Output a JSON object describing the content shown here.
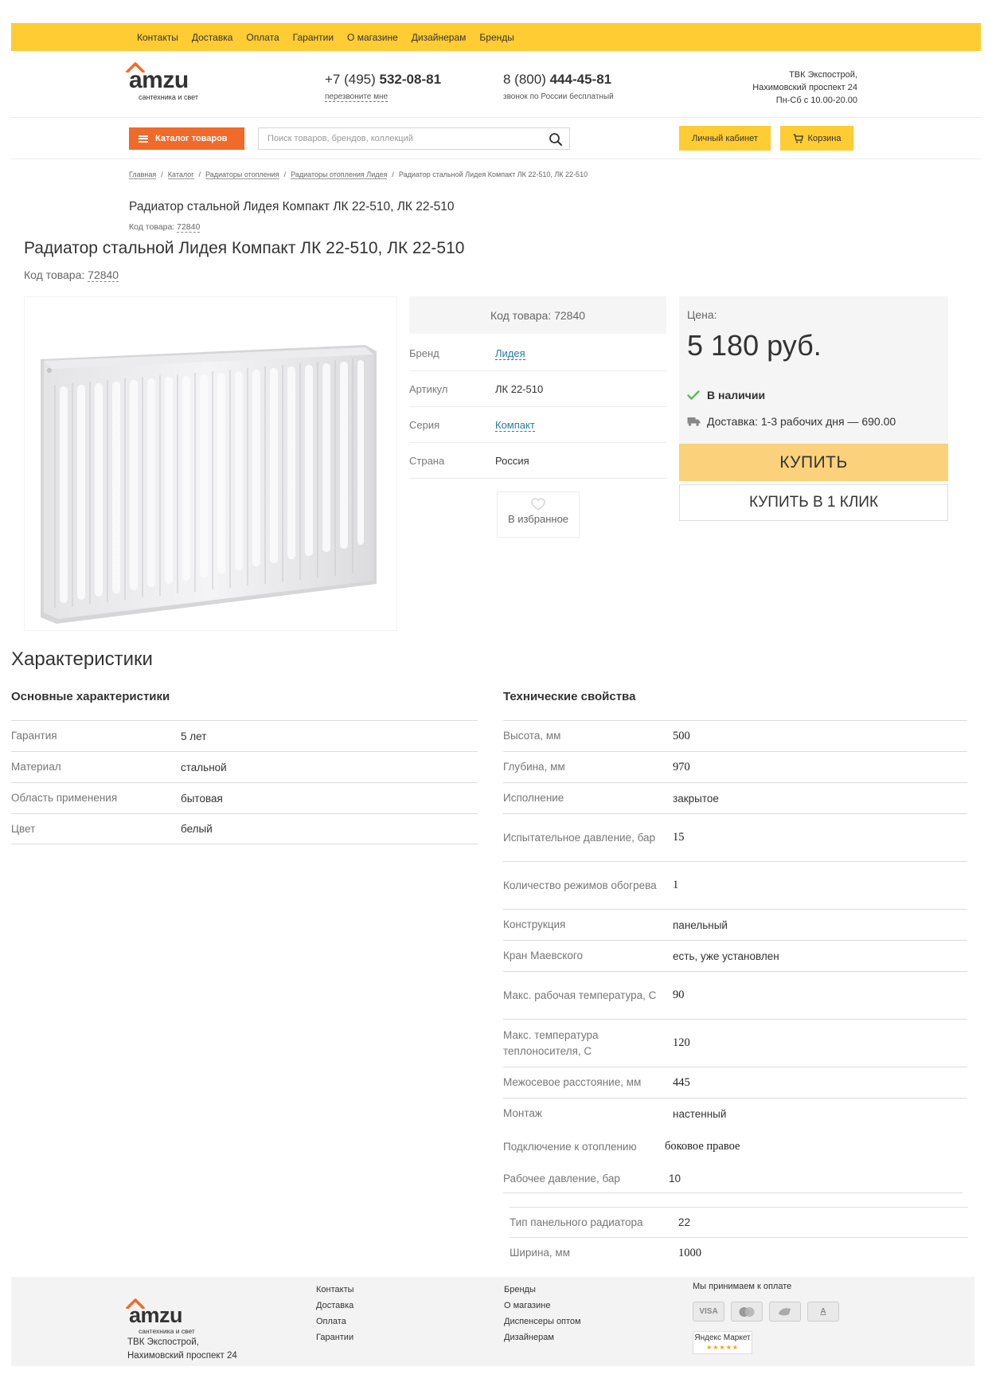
{
  "top_nav": [
    "Контакты",
    "Доставка",
    "Оплата",
    "Гарантии",
    "О магазине",
    "Дизайнерам",
    "Бренды"
  ],
  "logo": {
    "word": "amzu",
    "tagline": "сантехника и свет"
  },
  "header": {
    "phone1": {
      "prefix": "+7 (495) ",
      "number": "532-08-81",
      "sub": "перезвоните мне"
    },
    "phone2": {
      "prefix": "8 (800) ",
      "number": "444-45-81",
      "sub": "звонок по России бесплатный"
    },
    "address": [
      "ТВК Экспострой,",
      "Нахимовский проспект 24",
      "Пн-Сб с 10.00-20.00"
    ],
    "catalog_label": "Каталог товаров",
    "search_placeholder": "Поиск товаров, брендов, коллекций",
    "cabinet_label": "Личный кабинет",
    "cart_label": "Корзина"
  },
  "breadcrumb": [
    "Главная",
    "Каталог",
    "Радиаторы отопления",
    "Радиаторы отопления Лидея",
    "Радиатор стальной Лидея Компакт ЛК 22-510, ЛК 22-510"
  ],
  "product": {
    "title": "Радиатор стальной Лидея Компакт ЛК 22-510, ЛК 22-510",
    "code_label": "Код товара:",
    "code": "72840",
    "code_full": "Код товара: 72840",
    "specs": [
      {
        "key": "Бренд",
        "value": "Лидея"
      },
      {
        "key": "Артикул",
        "value": "ЛК 22-510"
      },
      {
        "key": "Серия",
        "value": "Компакт"
      },
      {
        "key": "Страна",
        "value": "Россия"
      }
    ],
    "favorite_label": "В избранное",
    "price_label": "Цена:",
    "price": "5 180 руб.",
    "stock": "В наличии",
    "delivery": "Доставка: 1-3 рабочих дня — 690.00",
    "buy_label": "КУПИТЬ",
    "oneclick_label": "КУПИТЬ В 1 КЛИК"
  },
  "characteristics": {
    "title": "Характеристики",
    "basic_title": "Основные характеристики",
    "tech_title": "Технические свойства",
    "basic": [
      {
        "key": "Гарантия",
        "value": "5 лет"
      },
      {
        "key": "Материал",
        "value": "стальной"
      },
      {
        "key": "Область применения",
        "value": "бытовая"
      },
      {
        "key": "Цвет",
        "value": "белый"
      }
    ],
    "tech": [
      {
        "key": "Высота, мм",
        "value": "500"
      },
      {
        "key": "Глубина, мм",
        "value": "970"
      },
      {
        "key": "Исполнение",
        "value": "закрытое"
      },
      {
        "key": "Испытательное давление, бар",
        "value": "15"
      },
      {
        "key": "Количество режимов обогрева",
        "value": "1"
      },
      {
        "key": "Конструкция",
        "value": "панельный"
      },
      {
        "key": "Кран Маевского",
        "value": "есть, уже установлен"
      },
      {
        "key": "Макс. рабочая температура, С",
        "value": "90"
      },
      {
        "key": "Макс. температура теплоносителя, С",
        "value": "120"
      },
      {
        "key": "Межосевое расстояние, мм",
        "value": "445"
      },
      {
        "key": "Монтаж",
        "value": "настенный"
      },
      {
        "key": "Подключение к отоплению",
        "value": "боковое правое"
      },
      {
        "key": "Рабочее давление, бар",
        "value": "10"
      }
    ],
    "tech_extra": [
      {
        "key": "Тип панельного радиатора",
        "value": "22"
      },
      {
        "key": "Ширина, мм",
        "value": "1000"
      }
    ]
  },
  "footer": {
    "address": [
      "ТВК Экспострой,",
      "Нахимовский проспект 24"
    ],
    "col1": [
      "Контакты",
      "Доставка",
      "Оплата",
      "Гарантии"
    ],
    "col2": [
      "Бренды",
      "О магазине",
      "Диспенсеры оптом",
      "Дизайнерам"
    ],
    "pay_title": "Мы принимаем к оплате",
    "pay_icons": [
      "VISA",
      "mastercard-icon",
      "wallet-icon",
      "A"
    ],
    "yandex": "Яндекс Маркет"
  },
  "colors": {
    "accent_yellow": "#ffcc33",
    "catalog_orange": "#f06a2a",
    "buy_button": "#fbd27b",
    "link_blue": "#2a7aa8",
    "stock_green": "#5cb85c"
  }
}
